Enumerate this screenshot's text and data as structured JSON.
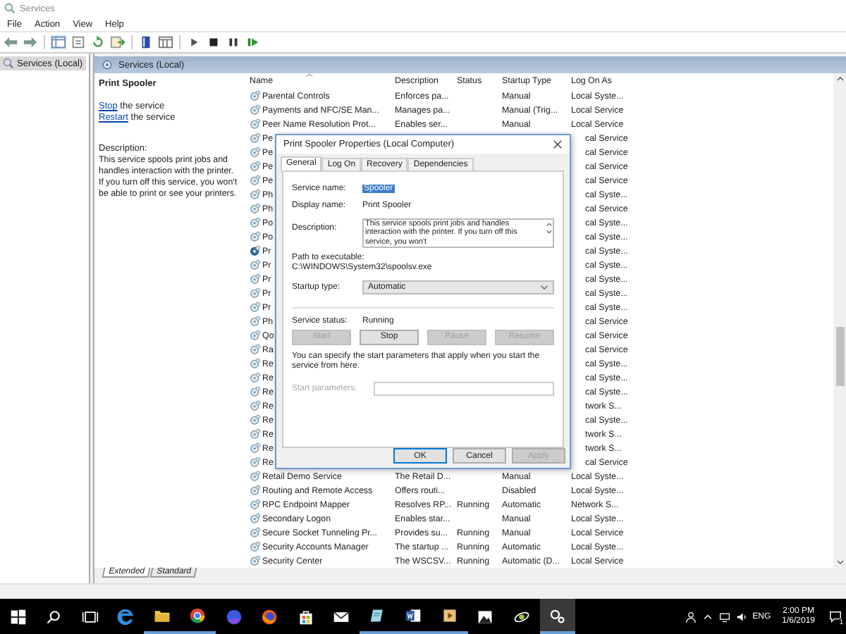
{
  "window": {
    "title": "Services"
  },
  "menu": [
    "File",
    "Action",
    "View",
    "Help"
  ],
  "tree": [
    {
      "label": "Services (Local)",
      "selected": true
    }
  ],
  "panel": {
    "title": "Services (Local)"
  },
  "details": {
    "name": "Print Spooler",
    "actions": [
      {
        "link": "Stop",
        "rest": " the service"
      },
      {
        "link": "Restart",
        "rest": " the service"
      }
    ],
    "description_label": "Description:",
    "description": "This service spools print jobs and handles interaction with the printer. If you turn off this service, you won't be able to print or see your printers."
  },
  "table": {
    "columns": [
      "Name",
      "Description",
      "Status",
      "Startup Type",
      "Log On As"
    ],
    "rows": [
      {
        "kind": "full",
        "selected": false,
        "cells": [
          "Parental Controls",
          "Enforces pa...",
          "",
          "Manual",
          "Local Syste..."
        ]
      },
      {
        "kind": "full",
        "selected": false,
        "cells": [
          "Payments and NFC/SE Man...",
          "Manages pa...",
          "",
          "Manual (Trig...",
          "Local Service"
        ]
      },
      {
        "kind": "full",
        "selected": false,
        "cells": [
          "Peer Name Resolution Prot...",
          "Enables ser...",
          "",
          "Manual",
          "Local Service"
        ]
      },
      {
        "kind": "covered",
        "selected": false,
        "name": "Pe",
        "log_on": "cal Service"
      },
      {
        "kind": "covered",
        "selected": false,
        "name": "Pe",
        "log_on": "cal Service"
      },
      {
        "kind": "covered",
        "selected": false,
        "name": "Pe",
        "log_on": "cal Service"
      },
      {
        "kind": "covered",
        "selected": false,
        "name": "Pe",
        "log_on": "cal Service"
      },
      {
        "kind": "covered",
        "selected": false,
        "name": "Ph",
        "log_on": "cal Syste..."
      },
      {
        "kind": "covered",
        "selected": false,
        "name": "Ph",
        "log_on": "cal Service"
      },
      {
        "kind": "covered",
        "selected": false,
        "name": "Po",
        "log_on": "cal Syste..."
      },
      {
        "kind": "covered",
        "selected": false,
        "name": "Po",
        "log_on": "cal Syste..."
      },
      {
        "kind": "covered",
        "selected": true,
        "name": "Pr",
        "log_on": "cal Syste..."
      },
      {
        "kind": "covered",
        "selected": false,
        "name": "Pr",
        "log_on": "cal Syste..."
      },
      {
        "kind": "covered",
        "selected": false,
        "name": "Pr",
        "log_on": "cal Syste..."
      },
      {
        "kind": "covered",
        "selected": false,
        "name": "Pr",
        "log_on": "cal Syste..."
      },
      {
        "kind": "covered",
        "selected": false,
        "name": "Pr",
        "log_on": "cal Syste..."
      },
      {
        "kind": "covered",
        "selected": false,
        "name": "Ph",
        "log_on": "cal Service"
      },
      {
        "kind": "covered",
        "selected": false,
        "name": "Qo",
        "log_on": "cal Service"
      },
      {
        "kind": "covered",
        "selected": false,
        "name": "Ra",
        "log_on": "cal Service"
      },
      {
        "kind": "covered",
        "selected": false,
        "name": "Re",
        "log_on": "cal Syste..."
      },
      {
        "kind": "covered",
        "selected": false,
        "name": "Re",
        "log_on": "cal Syste..."
      },
      {
        "kind": "covered",
        "selected": false,
        "name": "Re",
        "log_on": "cal Syste..."
      },
      {
        "kind": "covered",
        "selected": false,
        "name": "Re",
        "log_on": "twork S..."
      },
      {
        "kind": "covered",
        "selected": false,
        "name": "Re",
        "log_on": "cal Syste..."
      },
      {
        "kind": "covered",
        "selected": false,
        "name": "Re",
        "log_on": "twork S..."
      },
      {
        "kind": "covered",
        "selected": false,
        "name": "Re",
        "log_on": "twork S..."
      },
      {
        "kind": "covered",
        "selected": false,
        "name": "Re",
        "log_on": "cal Service"
      },
      {
        "kind": "full",
        "selected": false,
        "cells": [
          "Retail Demo Service",
          "The Retail D...",
          "",
          "Manual",
          "Local Syste..."
        ]
      },
      {
        "kind": "full",
        "selected": false,
        "cells": [
          "Routing and Remote Access",
          "Offers routi...",
          "",
          "Disabled",
          "Local Syste..."
        ]
      },
      {
        "kind": "full",
        "selected": false,
        "cells": [
          "RPC Endpoint Mapper",
          "Resolves RP...",
          "Running",
          "Automatic",
          "Network S..."
        ]
      },
      {
        "kind": "full",
        "selected": false,
        "cells": [
          "Secondary Logon",
          "Enables star...",
          "",
          "Manual",
          "Local Syste..."
        ]
      },
      {
        "kind": "full",
        "selected": false,
        "cells": [
          "Secure Socket Tunneling Pr...",
          "Provides su...",
          "Running",
          "Manual",
          "Local Service"
        ]
      },
      {
        "kind": "full",
        "selected": false,
        "cells": [
          "Security Accounts Manager",
          "The startup ...",
          "Running",
          "Automatic",
          "Local Syste..."
        ]
      },
      {
        "kind": "full",
        "selected": false,
        "cells": [
          "Security Center",
          "The WSCSV...",
          "Running",
          "Automatic (D...",
          "Local Service"
        ]
      }
    ]
  },
  "view_tabs": [
    {
      "label": "Extended",
      "selected": true
    },
    {
      "label": "Standard",
      "selected": false
    }
  ],
  "dialog": {
    "title": "Print Spooler Properties (Local Computer)",
    "tabs": [
      {
        "label": "General",
        "selected": true
      },
      {
        "label": "Log On",
        "selected": false
      },
      {
        "label": "Recovery",
        "selected": false
      },
      {
        "label": "Dependencies",
        "selected": false
      }
    ],
    "service_name": {
      "label": "Service name:",
      "value": "Spooler"
    },
    "display_name": {
      "label": "Display name:",
      "value": "Print Spooler"
    },
    "description": {
      "label": "Description:",
      "value": "This service spools print jobs and handles interaction with the printer.  If you turn off this service, you won't"
    },
    "path": {
      "label": "Path to executable:",
      "value": "C:\\WINDOWS\\System32\\spoolsv.exe"
    },
    "startup_type": {
      "label": "Startup type:",
      "value": "Automatic"
    },
    "service_status": {
      "label": "Service status:",
      "value": "Running"
    },
    "control_buttons": [
      {
        "label": "Start",
        "disabled": true
      },
      {
        "label": "Stop",
        "disabled": false
      },
      {
        "label": "Pause",
        "disabled": true
      },
      {
        "label": "Resume",
        "disabled": true
      }
    ],
    "hint": "You can specify the start parameters that apply when you start the service from here.",
    "start_parameters": {
      "label": "Start parameters:",
      "disabled": true
    },
    "buttons": [
      {
        "label": "OK",
        "default": true,
        "disabled": false
      },
      {
        "label": "Cancel",
        "default": false,
        "disabled": false
      },
      {
        "label": "Apply",
        "default": false,
        "disabled": true
      }
    ]
  },
  "taskbar": {
    "apps": [
      {
        "kind": "start",
        "running": false,
        "active": false
      },
      {
        "kind": "search",
        "running": false,
        "active": false
      },
      {
        "kind": "taskview",
        "running": false,
        "active": false
      },
      {
        "kind": "edge",
        "running": false,
        "active": false
      },
      {
        "kind": "folder",
        "running": true,
        "active": false
      },
      {
        "kind": "chrome",
        "running": true,
        "active": false
      },
      {
        "kind": "fox",
        "running": false,
        "active": false
      },
      {
        "kind": "fox2",
        "running": false,
        "active": false
      },
      {
        "kind": "store",
        "running": false,
        "active": false
      },
      {
        "kind": "mail",
        "running": false,
        "active": false
      },
      {
        "kind": "notes",
        "running": true,
        "active": false
      },
      {
        "kind": "word",
        "running": true,
        "active": false
      },
      {
        "kind": "video",
        "running": true,
        "active": false
      },
      {
        "kind": "photos",
        "running": false,
        "active": false
      },
      {
        "kind": "swirl",
        "running": false,
        "active": false
      },
      {
        "kind": "gears",
        "running": true,
        "active": true
      }
    ],
    "language": "ENG",
    "time": "2:00 PM",
    "date": "1/6/2019",
    "notifications": "1"
  }
}
